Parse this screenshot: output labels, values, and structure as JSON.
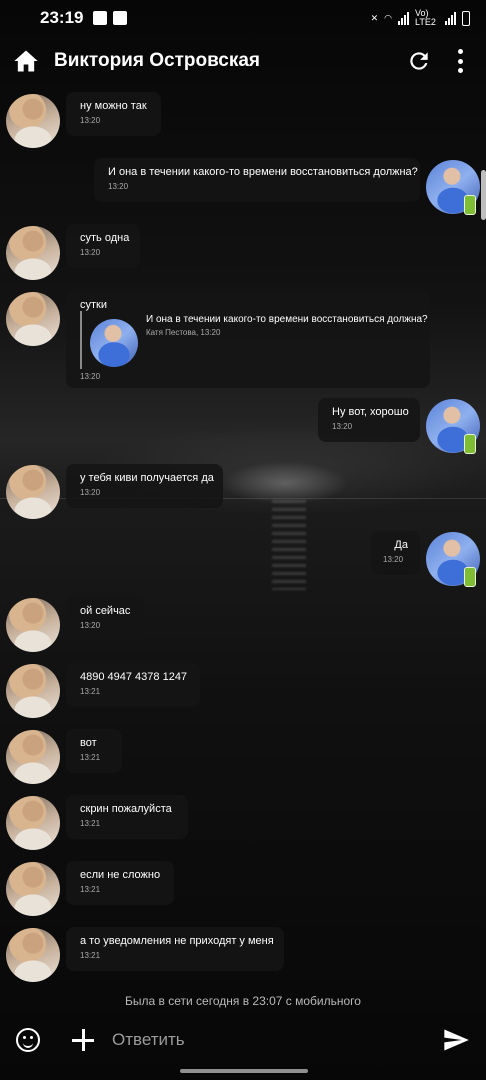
{
  "status_bar": {
    "time": "23:19",
    "network_label": "Vo) LTE2"
  },
  "header": {
    "title": "Виктория Островская",
    "icons": [
      "home-icon",
      "refresh-icon",
      "more-vert-icon"
    ]
  },
  "messages": [
    {
      "side": "in",
      "text": "ну можно так",
      "time": "13:20"
    },
    {
      "side": "out",
      "text": "И она в течении какого-то времени восстановиться должна?",
      "time": "13:20"
    },
    {
      "side": "in",
      "text": "суть одна",
      "time": "13:20"
    },
    {
      "side": "in",
      "text": "сутки",
      "time": "13:20",
      "quote": {
        "text": "И она в течении какого-то времени восстановиться должна?",
        "author_time": "Катя Пестова, 13:20"
      }
    },
    {
      "side": "out",
      "text": "Ну вот, хорошо",
      "time": "13:20"
    },
    {
      "side": "in",
      "text": "у тебя киви получается да",
      "time": "13:20"
    },
    {
      "side": "out",
      "text": "Да",
      "time": "13:20"
    },
    {
      "side": "in",
      "text": "ой сейчас",
      "time": "13:20"
    },
    {
      "side": "in",
      "text": "4890 4947 4378 1247",
      "time": "13:21"
    },
    {
      "side": "in",
      "text": "вот",
      "time": "13:21"
    },
    {
      "side": "in",
      "text": "скрин пожалуйста",
      "time": "13:21"
    },
    {
      "side": "in",
      "text": "если не сложно",
      "time": "13:21"
    },
    {
      "side": "in",
      "text": "а то уведомления не приходят у меня",
      "time": "13:21"
    }
  ],
  "footer": {
    "last_seen": "Была в сети сегодня в 23:07 с мобильного",
    "reply_placeholder": "Ответить"
  }
}
